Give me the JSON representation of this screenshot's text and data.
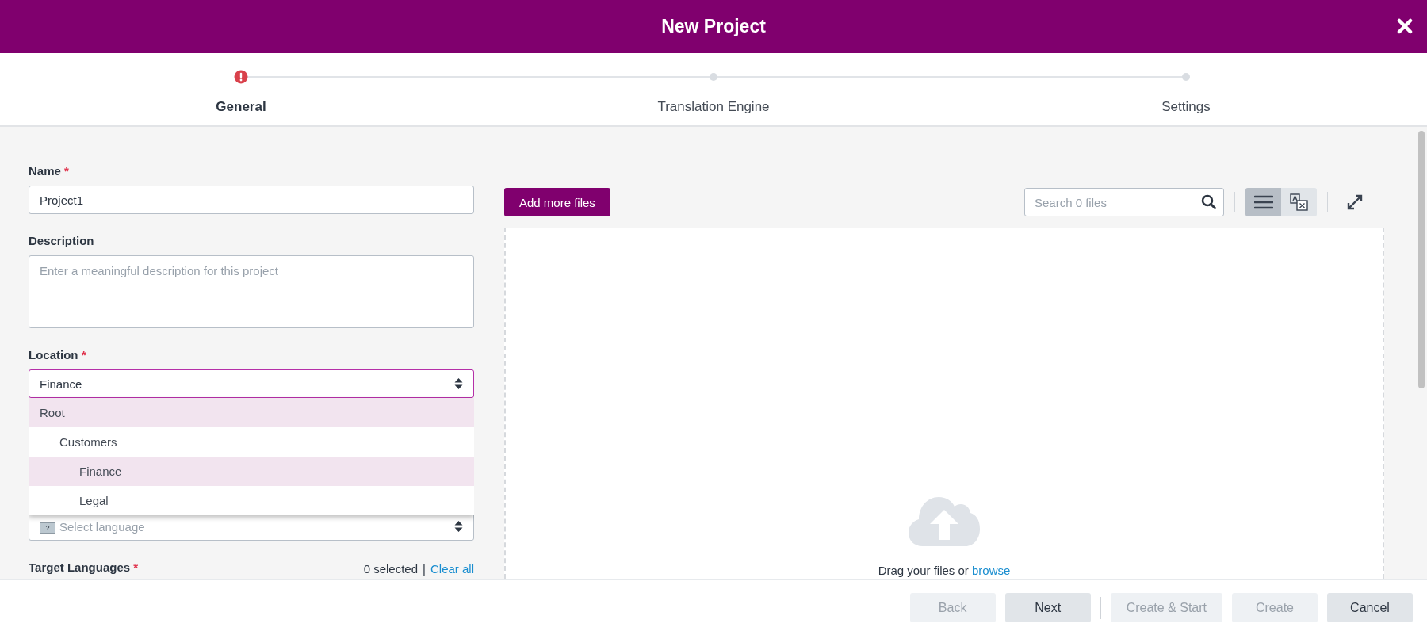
{
  "window": {
    "title": "New Project"
  },
  "steps": [
    {
      "label": "General",
      "selected": true,
      "error": true
    },
    {
      "label": "Translation Engine",
      "selected": false,
      "error": false
    },
    {
      "label": "Settings",
      "selected": false,
      "error": false
    }
  ],
  "form": {
    "name": {
      "label": "Name",
      "required_mark": "*",
      "value": "Project1"
    },
    "description": {
      "label": "Description",
      "placeholder": "Enter a meaningful description for this project"
    },
    "location": {
      "label": "Location",
      "required_mark": "*",
      "value": "Finance",
      "expanded": true,
      "options": [
        {
          "label": "Root",
          "highlighted": true,
          "children": [
            {
              "label": "Customers",
              "highlighted": false,
              "children": [
                {
                  "label": "Finance",
                  "highlighted": true
                },
                {
                  "label": "Legal",
                  "highlighted": false
                }
              ]
            }
          ]
        }
      ]
    },
    "source_language": {
      "flag": "?",
      "placeholder": "Select language"
    },
    "target_languages": {
      "label": "Target Languages",
      "required_mark": "*",
      "count": "0 selected",
      "separator": "|",
      "clear_link": "Clear all"
    }
  },
  "files": {
    "add_button": "Add more files",
    "search": {
      "placeholder": "Search 0 files"
    },
    "views": [
      {
        "kind": "list",
        "selected": true
      },
      {
        "kind": "translate",
        "selected": false
      }
    ],
    "drop_text": "Drag your files or",
    "browse_link": "browse"
  },
  "footer_buttons": [
    {
      "label": "Back",
      "disabled": true,
      "divider_after": false
    },
    {
      "label": "Next",
      "disabled": false,
      "divider_after": true
    },
    {
      "label": "Create & Start",
      "disabled": true,
      "divider_after": false
    },
    {
      "label": "Create",
      "disabled": true,
      "divider_after": false
    },
    {
      "label": "Cancel",
      "disabled": false,
      "divider_after": false
    }
  ]
}
